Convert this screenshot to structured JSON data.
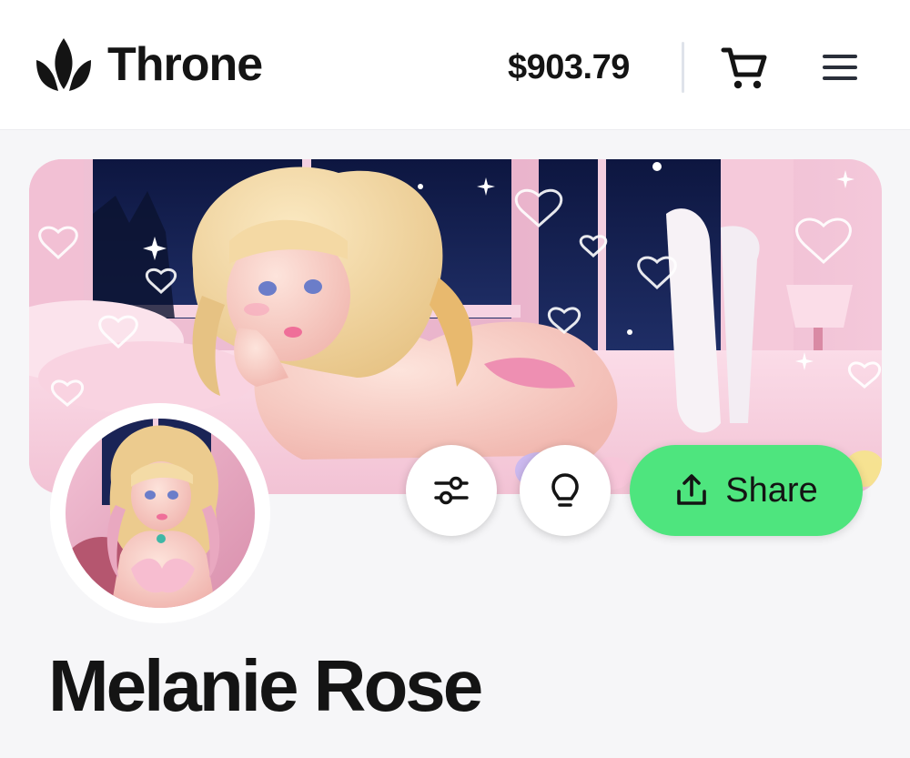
{
  "header": {
    "brand": "Throne",
    "balance": "$903.79",
    "icons": {
      "logo": "crown-icon",
      "cart": "cart-icon",
      "menu": "hamburger-menu-icon"
    }
  },
  "profile": {
    "display_name": "Melanie Rose",
    "banner_icon": "banner-image",
    "avatar_icon": "avatar-image",
    "actions": {
      "filters_icon": "sliders-icon",
      "hint_icon": "lightbulb-icon",
      "share_label": "Share",
      "share_icon": "share-upload-icon"
    }
  },
  "colors": {
    "accent_green": "#4ee57e",
    "text_dark": "#141414",
    "background": "#f6f6f8"
  }
}
